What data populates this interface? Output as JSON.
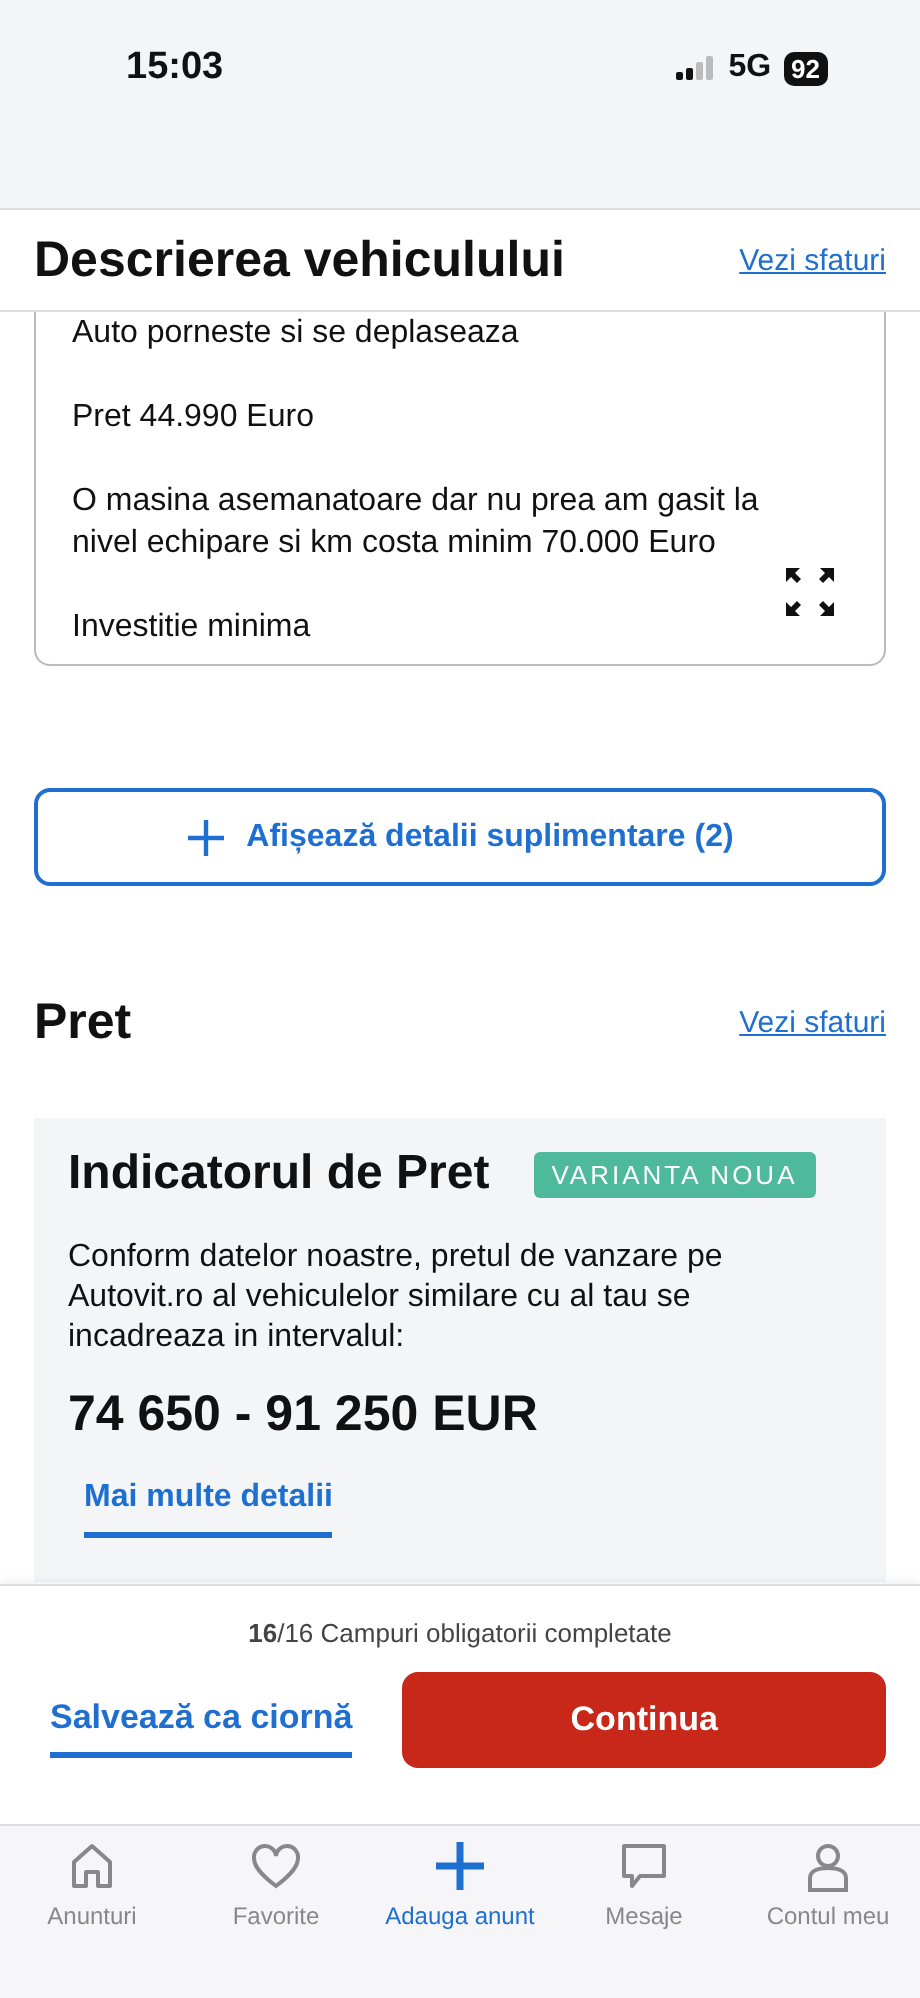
{
  "status_bar": {
    "time": "15:03",
    "network": "5G",
    "battery": "92"
  },
  "description_section": {
    "title": "Descrierea vehiculului",
    "tips_link": "Vezi sfaturi",
    "paragraphs": [
      "Auto porneste si se deplaseaza",
      "Pret 44.990 Euro",
      "O masina asemanatoare dar nu prea am gasit la nivel echipare si km costa minim 70.000 Euro",
      "Investitie minima"
    ],
    "more_details_button": "Afișează detalii suplimentare (2)"
  },
  "price_section": {
    "title": "Pret",
    "tips_link": "Vezi sfaturi",
    "card": {
      "title": "Indicatorul de Pret",
      "badge": "VARIANTA NOUA",
      "text": "Conform datelor noastre, pretul de vanzare pe Autovit.ro al vehiculelor similare cu al tau se incadreaza in intervalul:",
      "range": "74 650 - 91 250 EUR",
      "link": "Mai multe detalii"
    }
  },
  "footer": {
    "progress": "**16**/16 Campuri obligatorii completate",
    "save_draft": "Salvează ca ciornă",
    "continue": "Continua"
  },
  "tab_bar": [
    {
      "label": "Anunturi",
      "kind": "home",
      "selected": false
    },
    {
      "label": "Favorite",
      "kind": "heart",
      "selected": false
    },
    {
      "label": "Adauga anunt",
      "kind": "plus",
      "selected": true
    },
    {
      "label": "Mesaje",
      "kind": "chat",
      "selected": false
    },
    {
      "label": "Contul meu",
      "kind": "person",
      "selected": false
    }
  ]
}
